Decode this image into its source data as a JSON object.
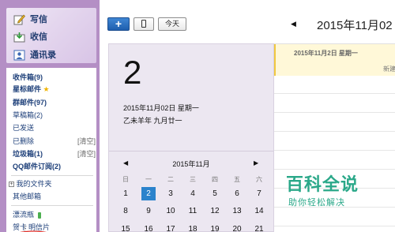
{
  "sidebar": {
    "write_label": "写信",
    "inbox_label": "收信",
    "contacts_label": "通讯录",
    "folders": [
      {
        "label": "收件箱(9)"
      },
      {
        "label": "星标邮件"
      },
      {
        "label": "群邮件(97)"
      },
      {
        "label": "草稿箱(2)"
      },
      {
        "label": "已发送"
      },
      {
        "label": "已删除",
        "extra": "[清空]"
      },
      {
        "label": "垃圾箱(1)",
        "extra": "[清空]"
      },
      {
        "label": "QQ邮件订阅(2)"
      }
    ],
    "my_folders_label": "我的文件夹",
    "other_mailbox_label": "其他邮箱",
    "drift_bottle_label": "漂流瓶",
    "greeting_label": "贺卡",
    "postcard_label": "明信片"
  },
  "toolbar": {
    "add_label": "+",
    "today_label": "今天",
    "prev_label": "◀",
    "period_title": "2015年11月02"
  },
  "day_card": {
    "big_day": "2",
    "full_date": "2015年11月02日 星期一",
    "lunar_date": "乙未羊年 九月廿一"
  },
  "mini_calendar": {
    "prev_label": "◀",
    "next_label": "▶",
    "title": "2015年11月",
    "weekdays": [
      "日",
      "一",
      "二",
      "三",
      "四",
      "五",
      "六"
    ],
    "rows": [
      [
        "1",
        "2",
        "3",
        "4",
        "5",
        "6",
        "7"
      ],
      [
        "8",
        "9",
        "10",
        "11",
        "12",
        "13",
        "14"
      ],
      [
        "15",
        "16",
        "17",
        "18",
        "19",
        "20",
        "21"
      ]
    ],
    "selected": "2"
  },
  "grid": {
    "date_header": "2015年11月2日 星期一",
    "new_label": "新建"
  },
  "watermark": {
    "title": "百科全说",
    "subtitle": "助你轻松解决"
  },
  "colors": {
    "sidebar_bg": "#b48fc5",
    "accent_blue": "#2b83cc",
    "watermark_green": "#2aa889"
  }
}
